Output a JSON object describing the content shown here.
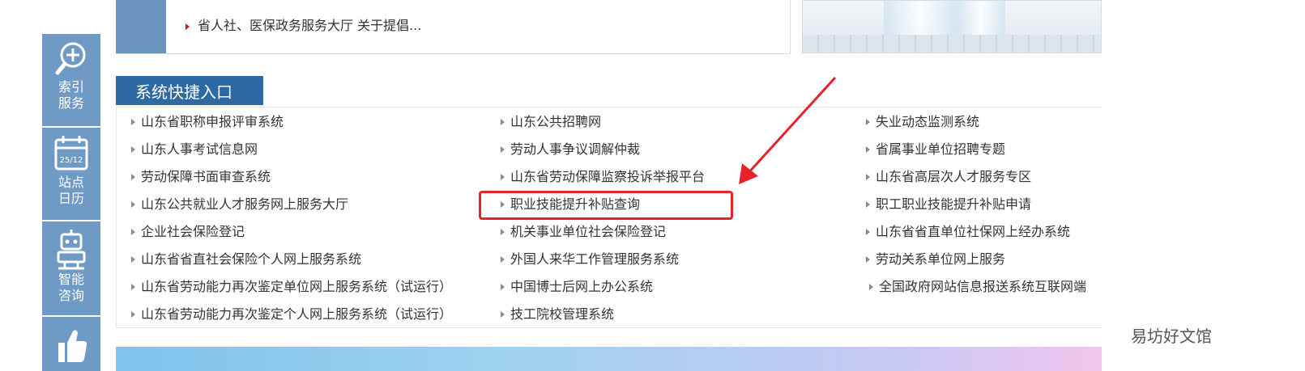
{
  "news": {
    "items": [
      {
        "text": "省人社、医保政务服务大厅 关于提倡..."
      }
    ]
  },
  "sidebar": {
    "items": [
      {
        "label_line1": "索引",
        "label_line2": "服务",
        "icon": "zoom-in-icon"
      },
      {
        "label_line1": "站点",
        "label_line2": "日历",
        "icon": "calendar-icon",
        "date": "25/12"
      },
      {
        "label_line1": "智能",
        "label_line2": "咨询",
        "icon": "robot-icon"
      },
      {
        "label_line1": "",
        "label_line2": "",
        "icon": "thumbs-up-icon"
      }
    ]
  },
  "section": {
    "title": "系统快捷入口"
  },
  "links": {
    "col1": [
      "山东省职称申报评审系统",
      "山东人事考试信息网",
      "劳动保障书面审查系统",
      "山东公共就业人才服务网上服务大厅",
      "企业社会保险登记",
      "山东省省直社会保险个人网上服务系统",
      "山东省劳动能力再次鉴定单位网上服务系统（试运行）",
      "山东省劳动能力再次鉴定个人网上服务系统（试运行）"
    ],
    "col2": [
      "山东公共招聘网",
      "劳动人事争议调解仲裁",
      "山东省劳动保障监察投诉举报平台",
      "职业技能提升补贴查询",
      "机关事业单位社会保险登记",
      "外国人来华工作管理服务系统",
      "中国博士后网上办公系统",
      "技工院校管理系统"
    ],
    "col3": [
      "失业动态监测系统",
      "省属事业单位招聘专题",
      "山东省高层次人才服务专区",
      "职工职业技能提升补贴申请",
      "山东省省直单位社保网上经办系统",
      "劳动关系单位网上服务",
      "全国政府网站信息报送系统互联网端"
    ]
  },
  "watermark": {
    "text": "易坊好文馆"
  },
  "colors": {
    "sidebar": "#6f9ac6",
    "section_header": "#2d6aa3",
    "highlight": "#e5232b"
  }
}
